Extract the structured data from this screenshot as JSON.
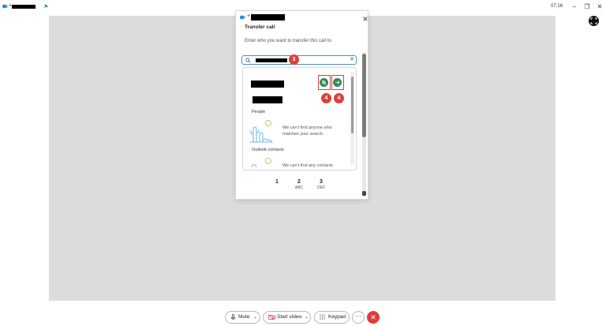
{
  "titlebar": {
    "plus": "+",
    "time": "07:16",
    "minimize": "–",
    "restore": "❐",
    "close": "✕"
  },
  "dialog": {
    "plus": "+",
    "close": "✕",
    "title": "Transfer call",
    "subtitle": "Enter who you want to transfer this call to.",
    "search_clear": "✕"
  },
  "markers": {
    "search": "3",
    "action_left": "4",
    "action_right": "4"
  },
  "results": {
    "people_label": "People",
    "people_empty": "We can't find anyone who matches your search.",
    "outlook_label": "Outlook contacts",
    "outlook_empty_partial": "We can't find any contacts who"
  },
  "keypad": [
    {
      "digit": "1",
      "letters": ""
    },
    {
      "digit": "2",
      "letters": "ABC"
    },
    {
      "digit": "3",
      "letters": "DEF"
    }
  ],
  "controls": {
    "mute": "Mute",
    "start_video": "Start video",
    "keypad": "Keypad",
    "more": "···",
    "end_call": "✕",
    "chevron": "⌄"
  },
  "colors": {
    "accent": "#4a90c9",
    "action_green": "#2e8b57",
    "annotation_red": "#d9413b",
    "end_call_red": "#e03b3b"
  }
}
